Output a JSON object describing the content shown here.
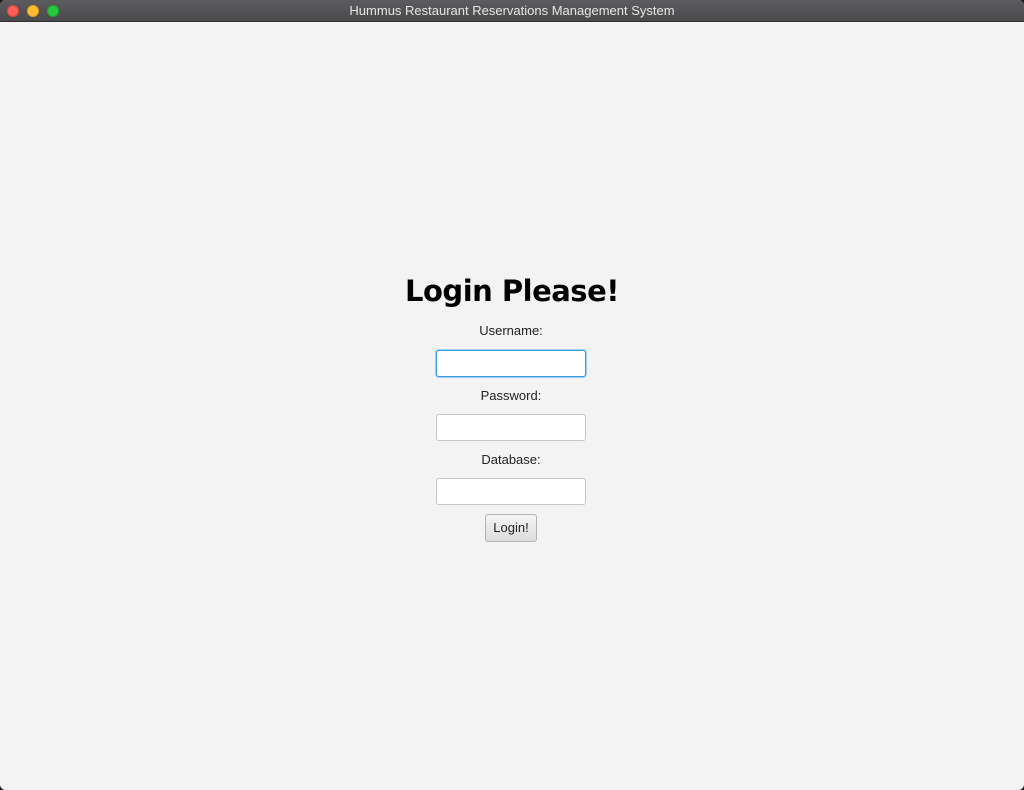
{
  "window": {
    "title": "Hummus Restaurant Reservations Management System"
  },
  "login": {
    "heading": "Login Please!",
    "username_label": "Username:",
    "username_value": "",
    "password_label": "Password:",
    "password_value": "",
    "database_label": "Database:",
    "database_value": "",
    "login_button": "Login!"
  },
  "colors": {
    "background": "#f3f3f3",
    "focus_ring": "#3a9de0",
    "close": "#fe5f57",
    "minimize": "#febc2e",
    "maximize": "#28c840"
  }
}
